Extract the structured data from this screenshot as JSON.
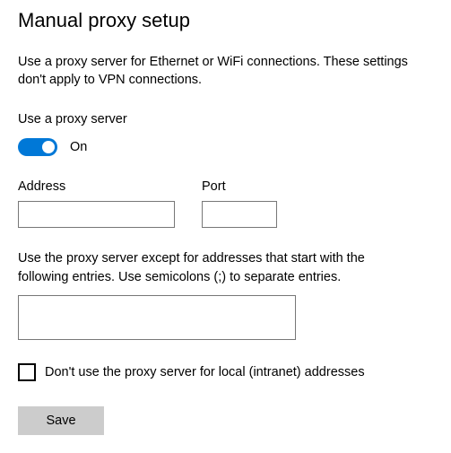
{
  "title": "Manual proxy setup",
  "description": "Use a proxy server for Ethernet or WiFi connections. These settings don't apply to VPN connections.",
  "toggle": {
    "label": "Use a proxy server",
    "state": "On",
    "on": true
  },
  "address": {
    "label": "Address",
    "value": ""
  },
  "port": {
    "label": "Port",
    "value": ""
  },
  "exceptions": {
    "description": "Use the proxy server except for addresses that start with the following entries. Use semicolons (;) to separate entries.",
    "value": ""
  },
  "localBypass": {
    "label": "Don't use the proxy server for local (intranet) addresses",
    "checked": false
  },
  "save": {
    "label": "Save"
  }
}
